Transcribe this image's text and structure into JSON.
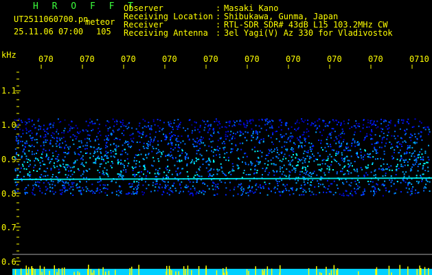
{
  "header": {
    "station": "H R O F F T",
    "filename": "UT2511060700.pn",
    "type_label": "meteor",
    "datetime": "25.11.06 07:00",
    "count": "105",
    "labels": [
      "Observer",
      "Receiving Location",
      "Receiver",
      "Receiving Antenna"
    ],
    "colons": [
      ":",
      ":",
      ":",
      ":"
    ],
    "values": [
      "Masaki Kano",
      "Shibukawa, Gunma, Japan",
      "RTL-SDR SDR# 43dB L15 103.2MHz CW",
      "3el Yagi(V) Az 330 for Vladivostok"
    ]
  },
  "axis": {
    "unit": "kHz",
    "time_ticks": [
      "070",
      "070",
      "070",
      "070",
      "070",
      "070",
      "070",
      "070",
      "070",
      "0710"
    ],
    "freq_ticks": [
      "1.1",
      "1.0",
      "0.9",
      "0.8",
      "0.7",
      "0.6"
    ]
  },
  "colors": {
    "text": "#ffff00",
    "station": "#3cff3c",
    "background": "#000000",
    "noise_low": "#0000cc",
    "noise_high": "#00ffff",
    "trace": "#00ffff"
  }
}
